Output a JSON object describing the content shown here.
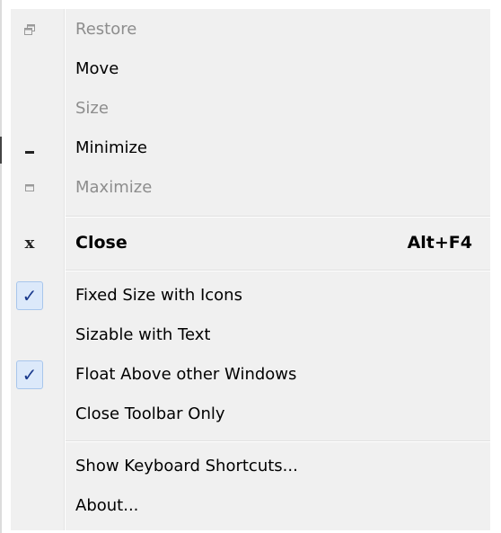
{
  "menu": {
    "items": [
      {
        "label": "Restore",
        "icon": "restore-icon",
        "disabled": true
      },
      {
        "label": "Move",
        "icon": null,
        "disabled": false
      },
      {
        "label": "Size",
        "icon": null,
        "disabled": true
      },
      {
        "label": "Minimize",
        "icon": "minimize-icon",
        "disabled": false
      },
      {
        "label": "Maximize",
        "icon": "maximize-icon",
        "disabled": true
      },
      {
        "label": "Close",
        "icon": "close-icon",
        "shortcut": "Alt+F4",
        "bold": true
      },
      {
        "label": "Fixed Size with Icons",
        "checked": true
      },
      {
        "label": "Sizable with Text",
        "checked": false
      },
      {
        "label": "Float Above other Windows",
        "checked": true
      },
      {
        "label": "Close Toolbar Only",
        "checked": false
      },
      {
        "label": "Show Keyboard Shortcuts..."
      },
      {
        "label": "About..."
      }
    ],
    "close_glyph": "x",
    "check_glyph": "✓"
  },
  "colors": {
    "menu_background": "#f0f0f0",
    "disabled_text": "#8d8d8d",
    "check_background": "#dce9fa",
    "check_border": "#a8c6ec"
  }
}
